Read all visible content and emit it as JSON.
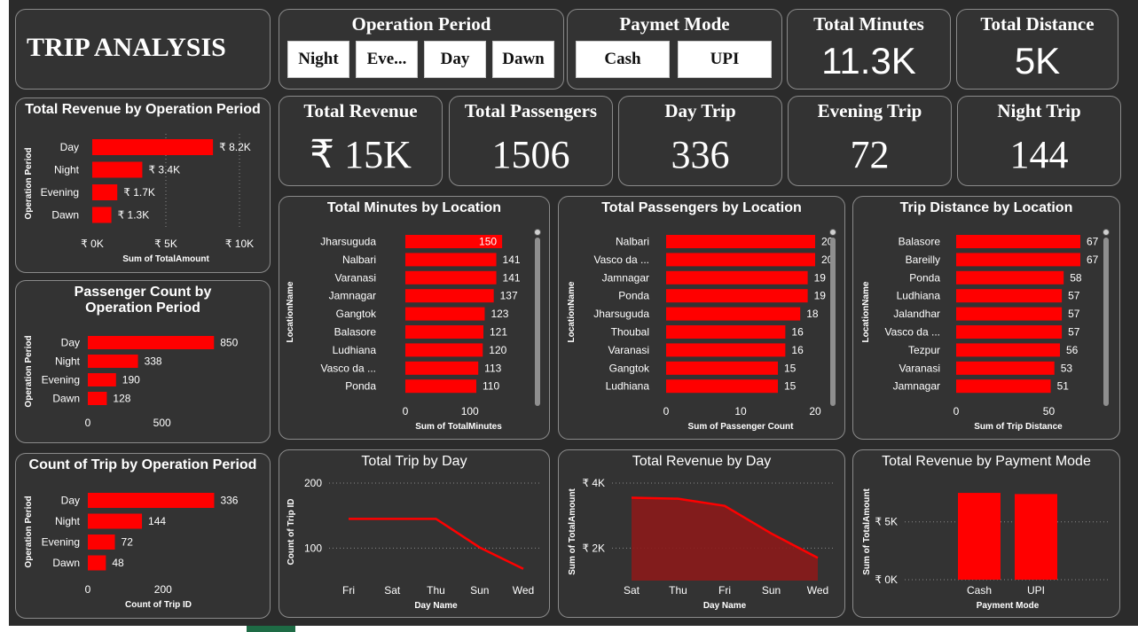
{
  "header": {
    "title": "TRIP ANALYSIS"
  },
  "slicers": {
    "operation_period": {
      "title": "Operation Period",
      "options": [
        "Night",
        "Eve...",
        "Day",
        "Dawn"
      ]
    },
    "payment_mode": {
      "title": "Paymet Mode",
      "options": [
        "Cash",
        "UPI"
      ]
    }
  },
  "kpis": {
    "total_minutes": {
      "label": "Total Minutes",
      "value": "11.3K"
    },
    "total_distance": {
      "label": "Total Distance",
      "value": "5K"
    },
    "total_revenue": {
      "label": "Total Revenue",
      "value": "₹ 15K"
    },
    "total_passengers": {
      "label": "Total Passengers",
      "value": "1506"
    },
    "day_trip": {
      "label": "Day Trip",
      "value": "336"
    },
    "evening_trip": {
      "label": "Evening Trip",
      "value": "72"
    },
    "night_trip": {
      "label": "Night Trip",
      "value": "144"
    }
  },
  "colors": {
    "bar": "#ff0000",
    "area": "#8b1a1a",
    "panel": "#333333",
    "background": "#2b2b2b",
    "text": "#ffffff"
  },
  "chart_data": [
    {
      "id": "rev_by_period",
      "type": "bar",
      "orientation": "horizontal",
      "title": "Total Revenue by Operation Period",
      "categories": [
        "Day",
        "Night",
        "Evening",
        "Dawn"
      ],
      "values": [
        8200,
        3400,
        1700,
        1300
      ],
      "labels": [
        "₹ 8.2K",
        "₹ 3.4K",
        "₹ 1.7K",
        "₹ 1.3K"
      ],
      "xlabel": "Sum of TotalAmount",
      "ylabel": "Operation Period",
      "xlim": [
        0,
        10000
      ],
      "xticks": [
        0,
        5000,
        10000
      ],
      "xtick_labels": [
        "₹ 0K",
        "₹ 5K",
        "₹ 10K"
      ],
      "grid": true
    },
    {
      "id": "pass_by_period",
      "type": "bar",
      "orientation": "horizontal",
      "title": "Passenger Count by Operation Period",
      "categories": [
        "Day",
        "Night",
        "Evening",
        "Dawn"
      ],
      "values": [
        850,
        338,
        190,
        128
      ],
      "labels": [
        "850",
        "338",
        "190",
        "128"
      ],
      "xlabel": "",
      "ylabel": "Operation Period",
      "xlim": [
        0,
        950
      ],
      "xticks": [
        0,
        500
      ],
      "xtick_labels": [
        "0",
        "500"
      ],
      "grid": false
    },
    {
      "id": "trips_by_period",
      "type": "bar",
      "orientation": "horizontal",
      "title": "Count of Trip by Operation Period",
      "categories": [
        "Day",
        "Night",
        "Evening",
        "Dawn"
      ],
      "values": [
        336,
        144,
        72,
        48
      ],
      "labels": [
        "336",
        "144",
        "72",
        "48"
      ],
      "xlabel": "Count of Trip ID",
      "ylabel": "Operation Period",
      "xlim": [
        0,
        375
      ],
      "xticks": [
        0,
        200
      ],
      "xtick_labels": [
        "0",
        "200"
      ],
      "grid": false
    },
    {
      "id": "minutes_by_loc",
      "type": "bar",
      "orientation": "horizontal",
      "title": "Total Minutes by Location",
      "categories": [
        "Jharsuguda",
        "Nalbari",
        "Varanasi",
        "Jamnagar",
        "Gangtok",
        "Balasore",
        "Ludhiana",
        "Vasco da ...",
        "Ponda"
      ],
      "values": [
        150,
        141,
        141,
        137,
        123,
        121,
        120,
        113,
        110
      ],
      "labels": [
        "150",
        "141",
        "141",
        "137",
        "123",
        "121",
        "120",
        "113",
        "110"
      ],
      "xlabel": "Sum of TotalMinutes",
      "ylabel": "LocationName",
      "xlim": [
        0,
        165
      ],
      "xticks": [
        0,
        100
      ],
      "xtick_labels": [
        "0",
        "100"
      ],
      "grid": false,
      "scrollbar": true
    },
    {
      "id": "pass_by_loc",
      "type": "bar",
      "orientation": "horizontal",
      "title": "Total Passengers by Location",
      "categories": [
        "Nalbari",
        "Vasco da ...",
        "Jamnagar",
        "Ponda",
        "Jharsuguda",
        "Thoubal",
        "Varanasi",
        "Gangtok",
        "Ludhiana"
      ],
      "values": [
        20,
        20,
        19,
        19,
        18,
        16,
        16,
        15,
        15
      ],
      "labels": [
        "20",
        "20",
        "19",
        "19",
        "18",
        "16",
        "16",
        "15",
        "15"
      ],
      "xlabel": "Sum of Passenger Count",
      "ylabel": "LocationName",
      "xlim": [
        0,
        20
      ],
      "xticks": [
        0,
        10,
        20
      ],
      "xtick_labels": [
        "0",
        "10",
        "20"
      ],
      "grid": false,
      "scrollbar": true
    },
    {
      "id": "dist_by_loc",
      "type": "bar",
      "orientation": "horizontal",
      "title": "Trip Distance by Location",
      "categories": [
        "Balasore",
        "Bareilly",
        "Ponda",
        "Ludhiana",
        "Jalandhar",
        "Vasco da ...",
        "Tezpur",
        "Varanasi",
        "Jamnagar"
      ],
      "values": [
        67,
        67,
        58,
        57,
        57,
        57,
        56,
        53,
        51
      ],
      "labels": [
        "67",
        "67",
        "58",
        "57",
        "57",
        "57",
        "56",
        "53",
        "51"
      ],
      "xlabel": "Sum of Trip Distance",
      "ylabel": "LocationName",
      "xlim": [
        0,
        67
      ],
      "xticks": [
        0,
        50
      ],
      "xtick_labels": [
        "0",
        "50"
      ],
      "grid": false,
      "scrollbar": true
    },
    {
      "id": "trip_by_day",
      "type": "line",
      "title": "Total Trip by Day",
      "categories": [
        "Fri",
        "Sat",
        "Thu",
        "Sun",
        "Wed"
      ],
      "values": [
        145,
        145,
        145,
        101,
        68
      ],
      "xlabel": "Day Name",
      "ylabel": "Count of Trip ID",
      "ylim": [
        50,
        200
      ],
      "yticks": [
        100,
        200
      ],
      "ytick_labels": [
        "100",
        "200"
      ],
      "grid": true
    },
    {
      "id": "rev_by_day",
      "type": "area",
      "title": "Total Revenue by Day",
      "categories": [
        "Sat",
        "Thu",
        "Fri",
        "Sun",
        "Wed"
      ],
      "values": [
        3550,
        3520,
        3300,
        2450,
        1700
      ],
      "xlabel": "Day Name",
      "ylabel": "Sum of TotalAmount",
      "ylim": [
        1000,
        4000
      ],
      "yticks": [
        2000,
        4000
      ],
      "ytick_labels": [
        "₹ 2K",
        "₹ 4K"
      ],
      "grid": true
    },
    {
      "id": "rev_by_pay",
      "type": "bar",
      "orientation": "vertical",
      "title": "Total Revenue by Payment Mode",
      "categories": [
        "Cash",
        "UPI"
      ],
      "values": [
        7500,
        7400
      ],
      "xlabel": "Payment Mode",
      "ylabel": "Sum of TotalAmount",
      "ylim": [
        0,
        8500
      ],
      "yticks": [
        0,
        5000
      ],
      "ytick_labels": [
        "₹ 0K",
        "₹ 5K"
      ],
      "grid": true
    }
  ]
}
